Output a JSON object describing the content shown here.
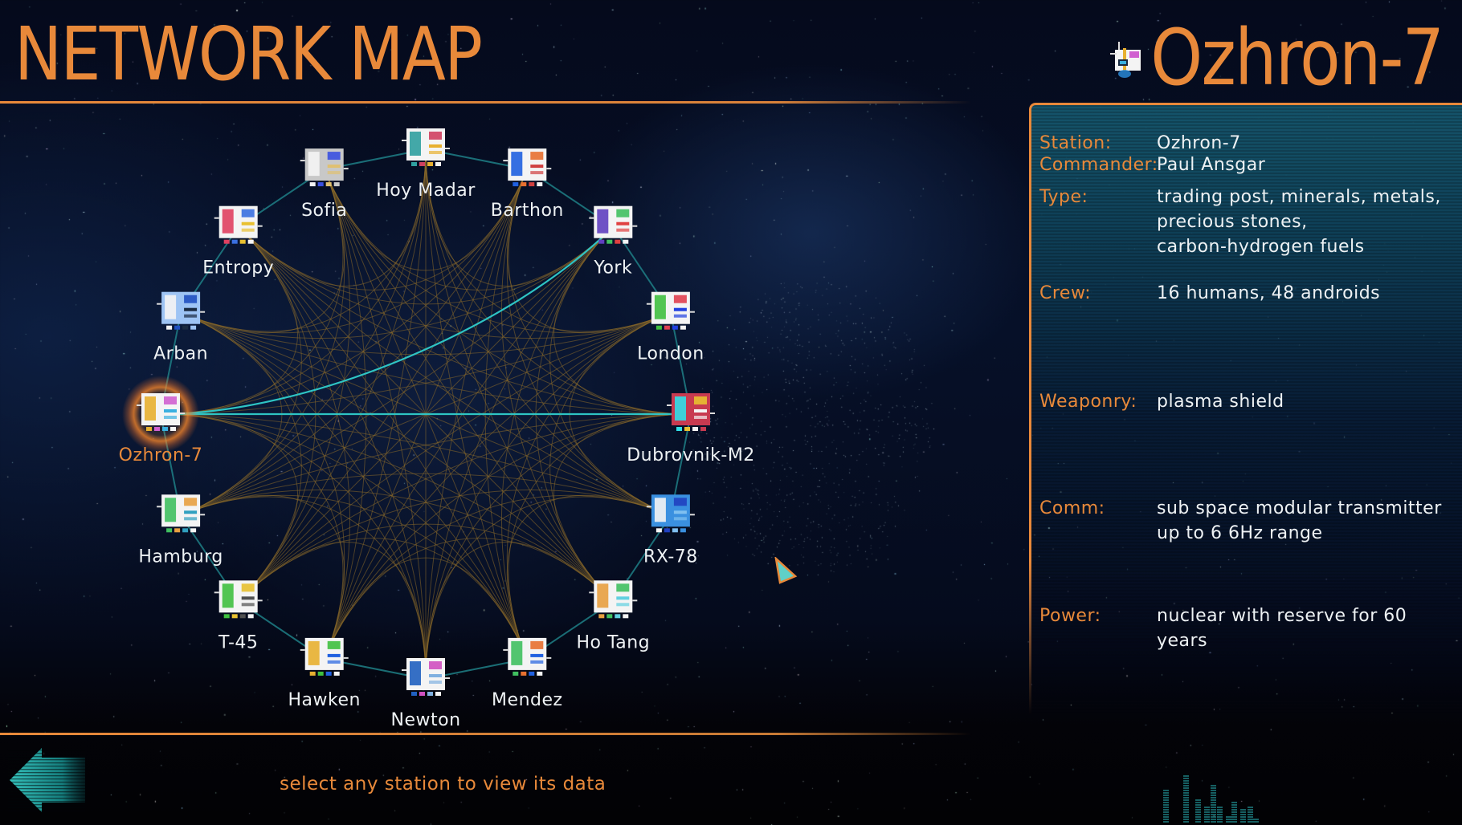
{
  "screen": {
    "title": "NETWORK MAP",
    "hint": "select any station to view its data"
  },
  "selected": {
    "name": "Ozhron-7",
    "fields": [
      {
        "label": "Station:",
        "lines": [
          "Ozhron-7"
        ]
      },
      {
        "label": "Commander:",
        "lines": [
          "Paul Ansgar"
        ]
      },
      {
        "label": "Type:",
        "lines": [
          "trading post, minerals, metals,",
          "precious stones,",
          "carbon-hydrogen fuels"
        ]
      },
      {
        "label": "Crew:",
        "lines": [
          "16 humans, 48 androids"
        ]
      },
      {
        "label": "Weaponry:",
        "lines": [
          "plasma shield"
        ]
      },
      {
        "label": "Comm:",
        "lines": [
          "sub space modular transmitter",
          "up to 6 6Hz range"
        ]
      },
      {
        "label": "Power:",
        "lines": [
          "nuclear with reserve for 60",
          "years"
        ]
      }
    ]
  },
  "stations": [
    {
      "name": "Hoy Madar",
      "icon": "station-hoy-madar-icon"
    },
    {
      "name": "Barthon",
      "icon": "station-barthon-icon"
    },
    {
      "name": "York",
      "icon": "station-york-icon"
    },
    {
      "name": "London",
      "icon": "station-london-icon"
    },
    {
      "name": "Dubrovnik-M2",
      "icon": "station-dubrovnik-icon"
    },
    {
      "name": "RX-78",
      "icon": "station-rx78-icon"
    },
    {
      "name": "Ho Tang",
      "icon": "station-ho-tang-icon"
    },
    {
      "name": "Mendez",
      "icon": "station-mendez-icon"
    },
    {
      "name": "Newton",
      "icon": "station-newton-icon"
    },
    {
      "name": "Hawken",
      "icon": "station-hawken-icon"
    },
    {
      "name": "T-45",
      "icon": "station-t45-icon"
    },
    {
      "name": "Hamburg",
      "icon": "station-hamburg-icon"
    },
    {
      "name": "Ozhron-7",
      "icon": "station-ozhron-icon",
      "selected": true
    },
    {
      "name": "Arban",
      "icon": "station-arban-icon"
    },
    {
      "name": "Entropy",
      "icon": "station-entropy-icon"
    },
    {
      "name": "Sofia",
      "icon": "station-sofia-icon"
    }
  ],
  "highlighted_links": [
    "Arban",
    "York",
    "Dubrovnik-M2",
    "Hamburg"
  ],
  "icons": {
    "back": "back-arrow-icon",
    "signal": "signal-equalizer-icon",
    "cursor": "pointer-cursor-icon"
  },
  "colors": {
    "accent": "#e8893a",
    "link_active": "#2ec4c4",
    "link_idle": "#8a6a2a",
    "ring": "#1f7f86",
    "text": "#eef2f4"
  }
}
